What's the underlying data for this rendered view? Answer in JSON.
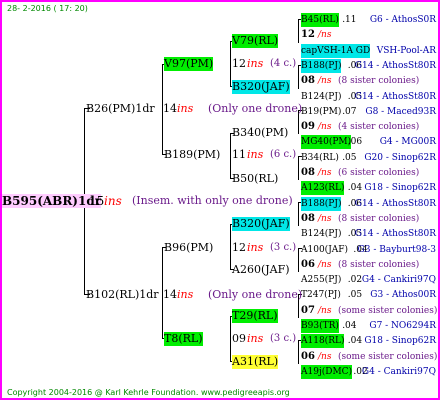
{
  "header": {
    "date": "28-  2-2016 ( 17: 20)"
  },
  "footer": {
    "copyright": "Copyright 2004-2016 @ Karl Kehrle Foundation.   www.pedigreeapis.org"
  },
  "root": {
    "id": "B595(ABR)1dr",
    "year": "15",
    "mating": "ins",
    "note": "(Insem. with only one drone)"
  },
  "gen1": [
    {
      "id": "B26(PM)1dr",
      "year": "14",
      "mating": "ins",
      "note": "(Only one drone)"
    },
    {
      "id": "B102(RL)1dr",
      "year": "14",
      "mating": "ins",
      "note": "(Only one drone)"
    }
  ],
  "gen2": [
    {
      "id": "V97(PM)"
    },
    {
      "id": "B189(PM)"
    },
    {
      "id": "B96(PM)"
    },
    {
      "id": "T8(RL)"
    }
  ],
  "gen3": [
    {
      "id": "V79(RL)",
      "year": "12",
      "mating": "ins",
      "note": "(4 c.)"
    },
    {
      "id": "B320(JAF)"
    },
    {
      "id": "B340(PM)",
      "year": "11",
      "mating": "ins",
      "note": "(6 c.)"
    },
    {
      "id": "B50(RL)"
    },
    {
      "id": "B320(JAF)",
      "year": "12",
      "mating": "ins",
      "note": "(3 c.)"
    },
    {
      "id": "A260(JAF)"
    },
    {
      "id": "T29(RL)",
      "year": "09",
      "mating": "ins",
      "note": "(3 c.)"
    },
    {
      "id": "A31(RL)"
    }
  ],
  "gen4": [
    {
      "kind": "queen",
      "id": "B45(RL)",
      "year": ".11",
      "origin": "G6 - AthosS0R",
      "hl": "grn"
    },
    {
      "kind": "mating",
      "year": "12",
      "mating": "/ns",
      "note": ""
    },
    {
      "kind": "queen",
      "id": "capVSH-1A GD",
      "year": "",
      "origin": "VSH-Pool-AR",
      "hl": "cyan"
    },
    {
      "kind": "queen",
      "id": "B188(PJ)",
      "year": ".06",
      "origin": "G14 - AthosSt80R",
      "hl": "cyan"
    },
    {
      "kind": "mating",
      "year": "08",
      "mating": "/ns",
      "note": "(8 sister colonies)"
    },
    {
      "kind": "queen",
      "id": "B124(PJ)",
      "year": ".05",
      "origin": "G14 - AthosSt80R",
      "hl": ""
    },
    {
      "kind": "queen",
      "id": "B19(PM)",
      "year": ".07",
      "origin": "G8 - Maced93R",
      "hl": ""
    },
    {
      "kind": "mating",
      "year": "09",
      "mating": "/ns",
      "note": "(4 sister colonies)"
    },
    {
      "kind": "queen",
      "id": "MG40(PM)",
      "year": ".06",
      "origin": "G4 - MG00R",
      "hl": "grn"
    },
    {
      "kind": "queen",
      "id": "B34(RL)",
      "year": ".05",
      "origin": "G20 - Sinop62R",
      "hl": ""
    },
    {
      "kind": "mating",
      "year": "08",
      "mating": "/ns",
      "note": "(6 sister colonies)"
    },
    {
      "kind": "queen",
      "id": "A123(RL)",
      "year": ".04",
      "origin": "G18 - Sinop62R",
      "hl": "grn"
    },
    {
      "kind": "queen",
      "id": "B188(PJ)",
      "year": ".06",
      "origin": "G14 - AthosSt80R",
      "hl": "cyan"
    },
    {
      "kind": "mating",
      "year": "08",
      "mating": "/ns",
      "note": "(8 sister colonies)"
    },
    {
      "kind": "queen",
      "id": "B124(PJ)",
      "year": ".05",
      "origin": "G14 - AthosSt80R",
      "hl": ""
    },
    {
      "kind": "queen",
      "id": "A100(JAF)",
      "year": ".04",
      "origin": "G3 - Bayburt98-3",
      "hl": ""
    },
    {
      "kind": "mating",
      "year": "06",
      "mating": "/ns",
      "note": "(8 sister colonies)"
    },
    {
      "kind": "queen",
      "id": "A255(PJ)",
      "year": ".02",
      "origin": "G4 - Cankiri97Q",
      "hl": ""
    },
    {
      "kind": "queen",
      "id": "T247(PJ)",
      "year": ".05",
      "origin": "G3 - Athos00R",
      "hl": ""
    },
    {
      "kind": "mating",
      "year": "07",
      "mating": "/ns",
      "note": "(some sister colonies)"
    },
    {
      "kind": "queen",
      "id": "B93(TR)",
      "year": ".04",
      "origin": "G7 - NO6294R",
      "hl": "grn"
    },
    {
      "kind": "queen",
      "id": "A118(RL)",
      "year": ".04",
      "origin": "G18 - Sinop62R",
      "hl": "grn"
    },
    {
      "kind": "mating",
      "year": "06",
      "mating": "/ns",
      "note": "(some sister colonies)"
    },
    {
      "kind": "queen",
      "id": "A19j(DMC)",
      "year": ".02",
      "origin": "G4 - Cankiri97Q",
      "hl": "grn"
    }
  ],
  "colors": {
    "border": "#ff00ff",
    "root_highlight": "#ffccff",
    "green_highlight": "#00ee00",
    "cyan_highlight": "#00e7e7",
    "yellow_highlight": "#ffff33",
    "ins_text": "#ff0000",
    "note_text": "#6a1a8a",
    "origin_text": "#0000aa",
    "footer_text": "#008800"
  }
}
